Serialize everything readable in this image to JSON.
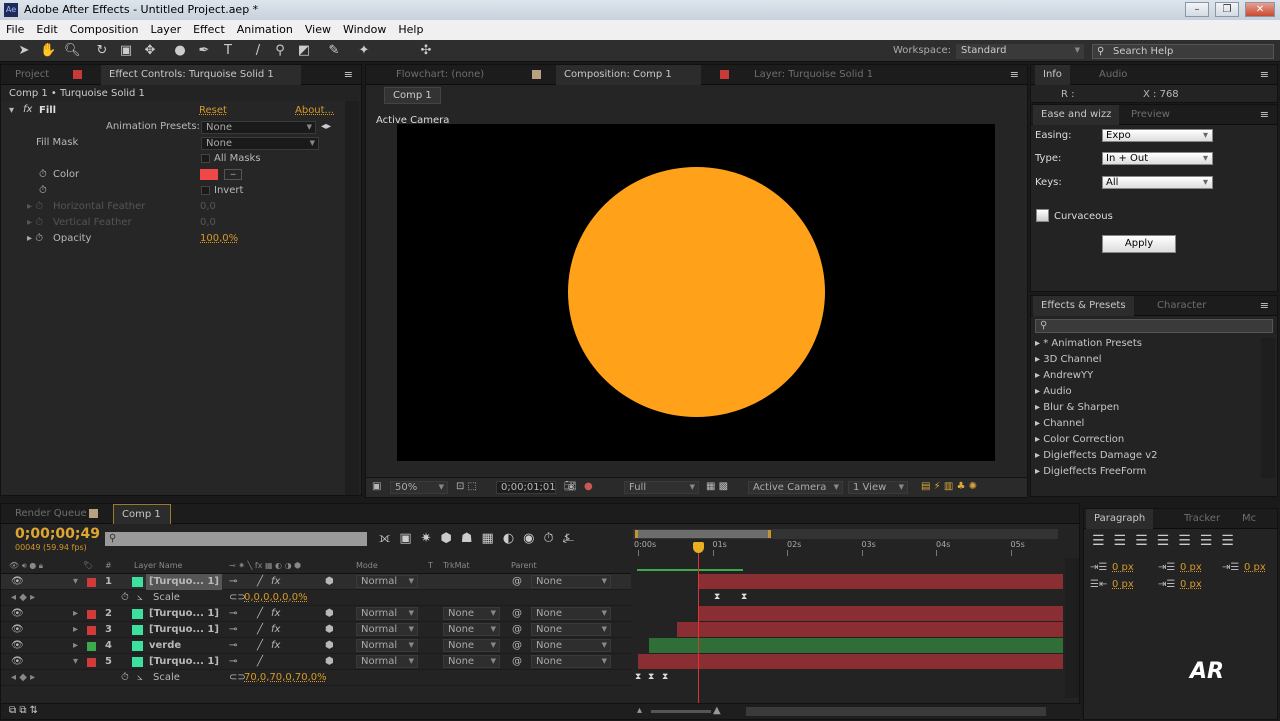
{
  "window": {
    "title": "Adobe After Effects - Untitled Project.aep *",
    "logo": "Ae"
  },
  "menu": [
    "File",
    "Edit",
    "Composition",
    "Layer",
    "Effect",
    "Animation",
    "View",
    "Window",
    "Help"
  ],
  "toolbar": {
    "workspace_label": "Workspace:",
    "workspace_value": "Standard",
    "search_placeholder": "Search Help"
  },
  "left_panel": {
    "tabs": [
      "Project",
      "Effect Controls: Turquoise Solid 1"
    ],
    "breadcrumb": "Comp 1 • Turquoise Solid 1",
    "effect_name": "Fill",
    "reset": "Reset",
    "about": "About...",
    "anim_presets_label": "Animation Presets:",
    "anim_presets_value": "None",
    "fill_mask_label": "Fill Mask",
    "fill_mask_value": "None",
    "all_masks": "All Masks",
    "color_label": "Color",
    "color_value": "#f04848",
    "invert": "Invert",
    "h_feather_label": "Horizontal Feather",
    "h_feather_value": "0,0",
    "v_feather_label": "Vertical Feather",
    "v_feather_value": "0,0",
    "opacity_label": "Opacity",
    "opacity_value": "100,0%"
  },
  "viewer": {
    "tabs": [
      "Flowchart: (none)",
      "Composition: Comp 1",
      "Layer: Turquoise Solid 1"
    ],
    "comp_button": "Comp 1",
    "camera_label": "Active Camera",
    "circle_color": "#ffa21a",
    "zoom": "50%",
    "timecode": "0;00;01;01",
    "resolution": "Full",
    "camera": "Active Camera",
    "views": "1 View"
  },
  "info": {
    "tabs": [
      "Info",
      "Audio"
    ],
    "r": "R :",
    "x": "X : 768"
  },
  "ease": {
    "tabs": [
      "Ease and wizz",
      "Preview"
    ],
    "easing_label": "Easing:",
    "easing": "Expo",
    "type_label": "Type:",
    "type": "In + Out",
    "keys_label": "Keys:",
    "keys": "All",
    "curvaceous": "Curvaceous",
    "apply": "Apply"
  },
  "effects": {
    "tabs": [
      "Effects & Presets",
      "Character"
    ],
    "items": [
      "* Animation Presets",
      "3D Channel",
      "AndrewYY",
      "Audio",
      "Blur & Sharpen",
      "Channel",
      "Color Correction",
      "Digieffects Damage v2",
      "Digieffects FreeForm"
    ]
  },
  "timeline": {
    "tabs": [
      "Render Queue",
      "Comp 1"
    ],
    "timecode": "0;00;00;49",
    "frames": "00049 (59.94 fps)",
    "headers": {
      "num": "#",
      "layer_name": "Layer Name",
      "mode": "Mode",
      "t": "T",
      "trkmat": "TrkMat",
      "parent": "Parent"
    },
    "ruler": [
      "0:00s",
      "01s",
      "02s",
      "03s",
      "04s",
      "05s"
    ],
    "layers": [
      {
        "num": "1",
        "name": "[Turquo... 1]",
        "label": "#d03a3a",
        "mode": "Normal",
        "trkmat": "",
        "parent": "None",
        "fx": "fx",
        "bar_start": 0.8,
        "bar_color": "#8b2e33"
      },
      {
        "num": "2",
        "name": "[Turquo... 1]",
        "label": "#d03a3a",
        "mode": "Normal",
        "trkmat": "None",
        "parent": "None",
        "fx": "fx",
        "bar_start": 0.8,
        "bar_color": "#8b2e33"
      },
      {
        "num": "3",
        "name": "[Turquo... 1]",
        "label": "#d03a3a",
        "mode": "Normal",
        "trkmat": "None",
        "parent": "None",
        "fx": "fx",
        "bar_start": 0.53,
        "bar_color": "#8b2e33"
      },
      {
        "num": "4",
        "name": "verde",
        "label": "#3caa4a",
        "mode": "Normal",
        "trkmat": "None",
        "parent": "None",
        "fx": "fx",
        "bar_start": 0.15,
        "bar_color": "#2f6e36"
      },
      {
        "num": "5",
        "name": "[Turquo... 1]",
        "label": "#d03a3a",
        "mode": "Normal",
        "trkmat": "None",
        "parent": "None",
        "fx": "",
        "bar_start": 0,
        "bar_color": "#8b2e33"
      }
    ],
    "scale1": {
      "label": "Scale",
      "value": "0,0,0,0,0,0%"
    },
    "scale5": {
      "label": "Scale",
      "value": "70,0,70,0,70,0%"
    },
    "playhead_s": 0.8
  },
  "paragraph": {
    "tabs": [
      "Paragraph",
      "Tracker",
      "Mc"
    ],
    "values": [
      "0 px",
      "0 px",
      "0 px",
      "0 px",
      "0 px"
    ]
  },
  "watermark": "AR"
}
